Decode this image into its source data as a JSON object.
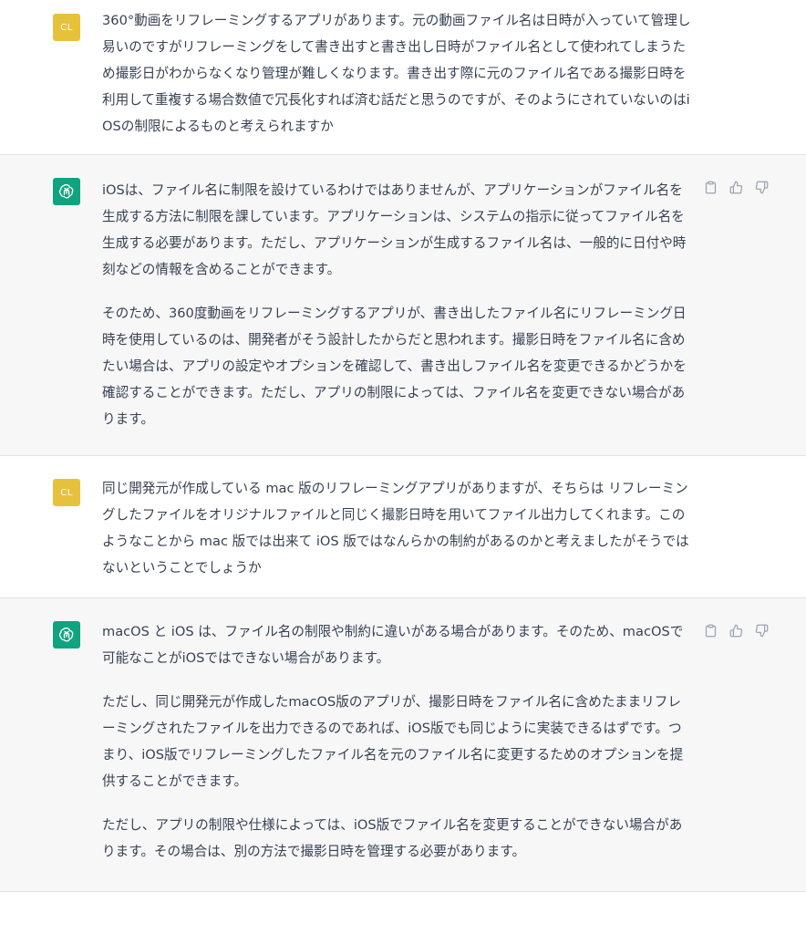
{
  "conversation": {
    "user_avatar_initials": "CL",
    "messages": [
      {
        "role": "user",
        "paragraphs": [
          "360°動画をリフレーミングするアプリがあります。元の動画ファイル名は日時が入っていて管理し易いのですがリフレーミングをして書き出すと書き出し日時がファイル名として使われてしまうため撮影日がわからなくなり管理が難しくなります。書き出す際に元のファイル名である撮影日時を利用して重複する場合数値で冗長化すれば済む話だと思うのですが、そのようにされていないのはiOSの制限によるものと考えられますか"
        ]
      },
      {
        "role": "assistant",
        "paragraphs": [
          "iOSは、ファイル名に制限を設けているわけではありませんが、アプリケーションがファイル名を生成する方法に制限を課しています。アプリケーションは、システムの指示に従ってファイル名を生成する必要があります。ただし、アプリケーションが生成するファイル名は、一般的に日付や時刻などの情報を含めることができます。",
          "そのため、360度動画をリフレーミングするアプリが、書き出したファイル名にリフレーミング日時を使用しているのは、開発者がそう設計したからだと思われます。撮影日時をファイル名に含めたい場合は、アプリの設定やオプションを確認して、書き出しファイル名を変更できるかどうかを確認することができます。ただし、アプリの制限によっては、ファイル名を変更できない場合があります。"
        ]
      },
      {
        "role": "user",
        "paragraphs": [
          "同じ開発元が作成している mac 版のリフレーミングアプリがありますが、そちらは リフレーミングしたファイルをオリジナルファイルと同じく撮影日時を用いてファイル出力してくれます。このようなことから mac 版では出来て iOS 版ではなんらかの制約があるのかと考えましたがそうではないということでしょうか"
        ]
      },
      {
        "role": "assistant",
        "paragraphs": [
          "macOS と iOS は、ファイル名の制限や制約に違いがある場合があります。そのため、macOSで可能なことがiOSではできない場合があります。",
          "ただし、同じ開発元が作成したmacOS版のアプリが、撮影日時をファイル名に含めたままリフレーミングされたファイルを出力できるのであれば、iOS版でも同じように実装できるはずです。つまり、iOS版でリフレーミングしたファイル名を元のファイル名に変更するためのオプションを提供することができます。",
          "ただし、アプリの制限や仕様によっては、iOS版でファイル名を変更することができない場合があります。その場合は、別の方法で撮影日時を管理する必要があります。"
        ]
      }
    ]
  },
  "icons": {
    "assistant_avatar": "openai-logo-icon",
    "copy": "clipboard-icon",
    "like": "thumbs-up-icon",
    "dislike": "thumbs-down-icon"
  },
  "colors": {
    "user_avatar": "#e8c13c",
    "assistant_avatar": "#10a37f",
    "assistant_bg": "#f7f7f8",
    "text": "#374151"
  }
}
